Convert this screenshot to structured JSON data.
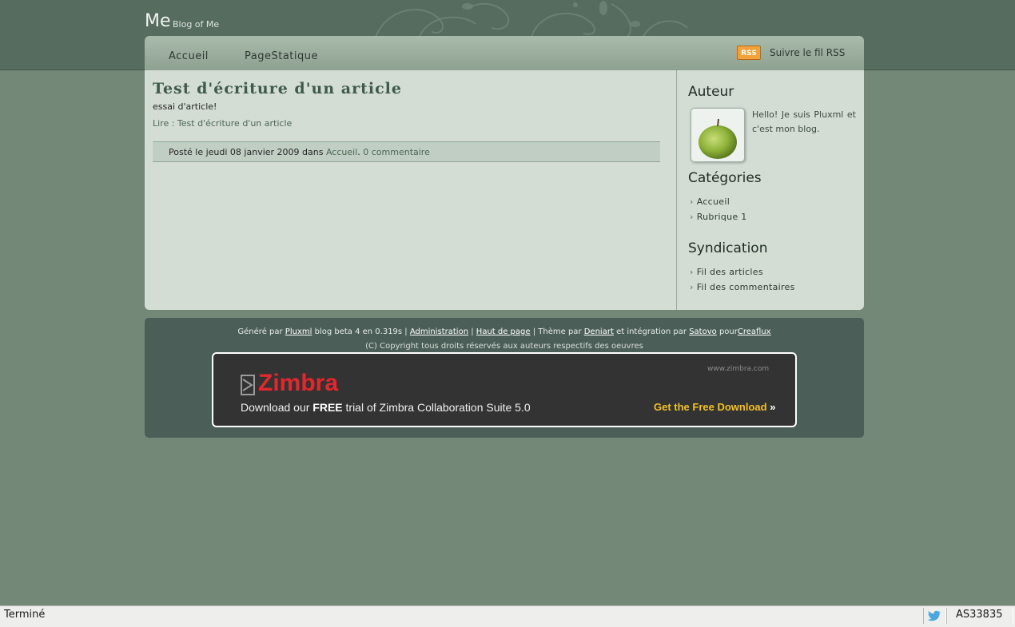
{
  "header": {
    "site_title": "Me",
    "site_subtitle": "Blog of Me"
  },
  "nav": {
    "items": [
      "Accueil",
      "PageStatique"
    ],
    "rss_icon": "RSS",
    "rss_label": "Suivre le fil RSS"
  },
  "article": {
    "title": "Test d'écriture d'un article",
    "body": "essai d'article!",
    "read_more": "Lire : Test d'écriture d'un article",
    "meta_prefix": "Posté le jeudi 08 janvier 2009 dans",
    "meta_category": "Accueil",
    "meta_comments": "0 commentaire"
  },
  "sidebar": {
    "author_heading": "Auteur",
    "author_text": "Hello! Je suis Pluxml et c'est mon blog.",
    "categories_heading": "Catégories",
    "categories": [
      "Accueil",
      "Rubrique 1"
    ],
    "syndication_heading": "Syndication",
    "syndication": [
      "Fil des articles",
      "Fil des commentaires"
    ]
  },
  "footer": {
    "gen": "Généré par",
    "pluxml": "Pluxml",
    "blog_info": "blog beta 4 en 0.319s |",
    "admin": "Administration",
    "sep": "|",
    "haut": "Haut de page",
    "theme": "| Thème par",
    "deniart": "Deniart",
    "integ": "et intégration par",
    "satovo": "Satovo",
    "pour": "pour",
    "creaflux": "Creaflux",
    "copyright": "(C) Copyright tous droits réservés aux auteurs respectifs des oeuvres"
  },
  "banner": {
    "logo": "Zimbra",
    "url": "www.zimbra.com",
    "tag_pre": "Download our",
    "tag_free": "FREE",
    "tag_post": "trial of Zimbra Collaboration Suite 5.0",
    "cta": "Get the Free Download",
    "cta_arrow": "»"
  },
  "statusbar": {
    "status": "Terminé",
    "as_number": "AS33835"
  },
  "colors": {
    "accent": "#3f5a4b",
    "background": "#748877",
    "banner_red": "#e4262d",
    "banner_cta": "#f3c11b"
  }
}
